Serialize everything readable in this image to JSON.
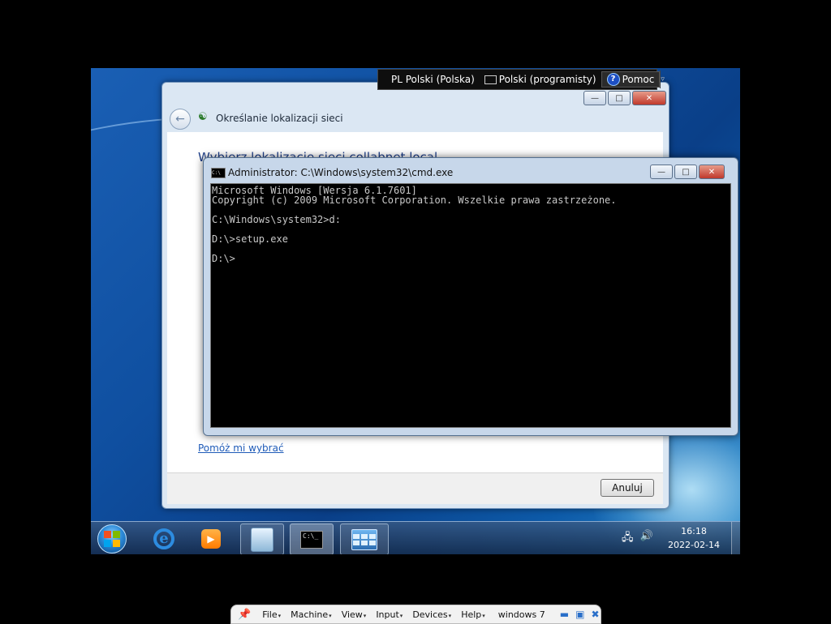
{
  "language_bar": {
    "input_language": "PL Polski (Polska)",
    "keyboard_layout": "Polski (programisty)",
    "help": "Pomoc"
  },
  "wizard": {
    "title": "Określanie lokalizacji sieci",
    "heading": "Wybierz lokalizację sieci collabnet.local",
    "help_link": "Pomóż mi wybrać",
    "cancel": "Anuluj"
  },
  "cmd": {
    "title": "Administrator: C:\\Windows\\system32\\cmd.exe",
    "output": "Microsoft Windows [Wersja 6.1.7601]\nCopyright (c) 2009 Microsoft Corporation. Wszelkie prawa zastrzeżone.\n\nC:\\Windows\\system32>d:\n\nD:\\>setup.exe\n\nD:\\>"
  },
  "taskbar": {
    "icons": [
      "windows-start-orb",
      "internet-explorer-icon",
      "media-player-icon",
      "windows-explorer-icon",
      "cmd-icon",
      "control-panel-icon"
    ],
    "cmd_icon_text": "C:\\_",
    "clock_time": "16:18",
    "clock_date": "2022-02-14"
  },
  "host_bar": {
    "menus": [
      "File",
      "Machine",
      "View",
      "Input",
      "Devices",
      "Help"
    ],
    "vm_name": "windows 7"
  }
}
